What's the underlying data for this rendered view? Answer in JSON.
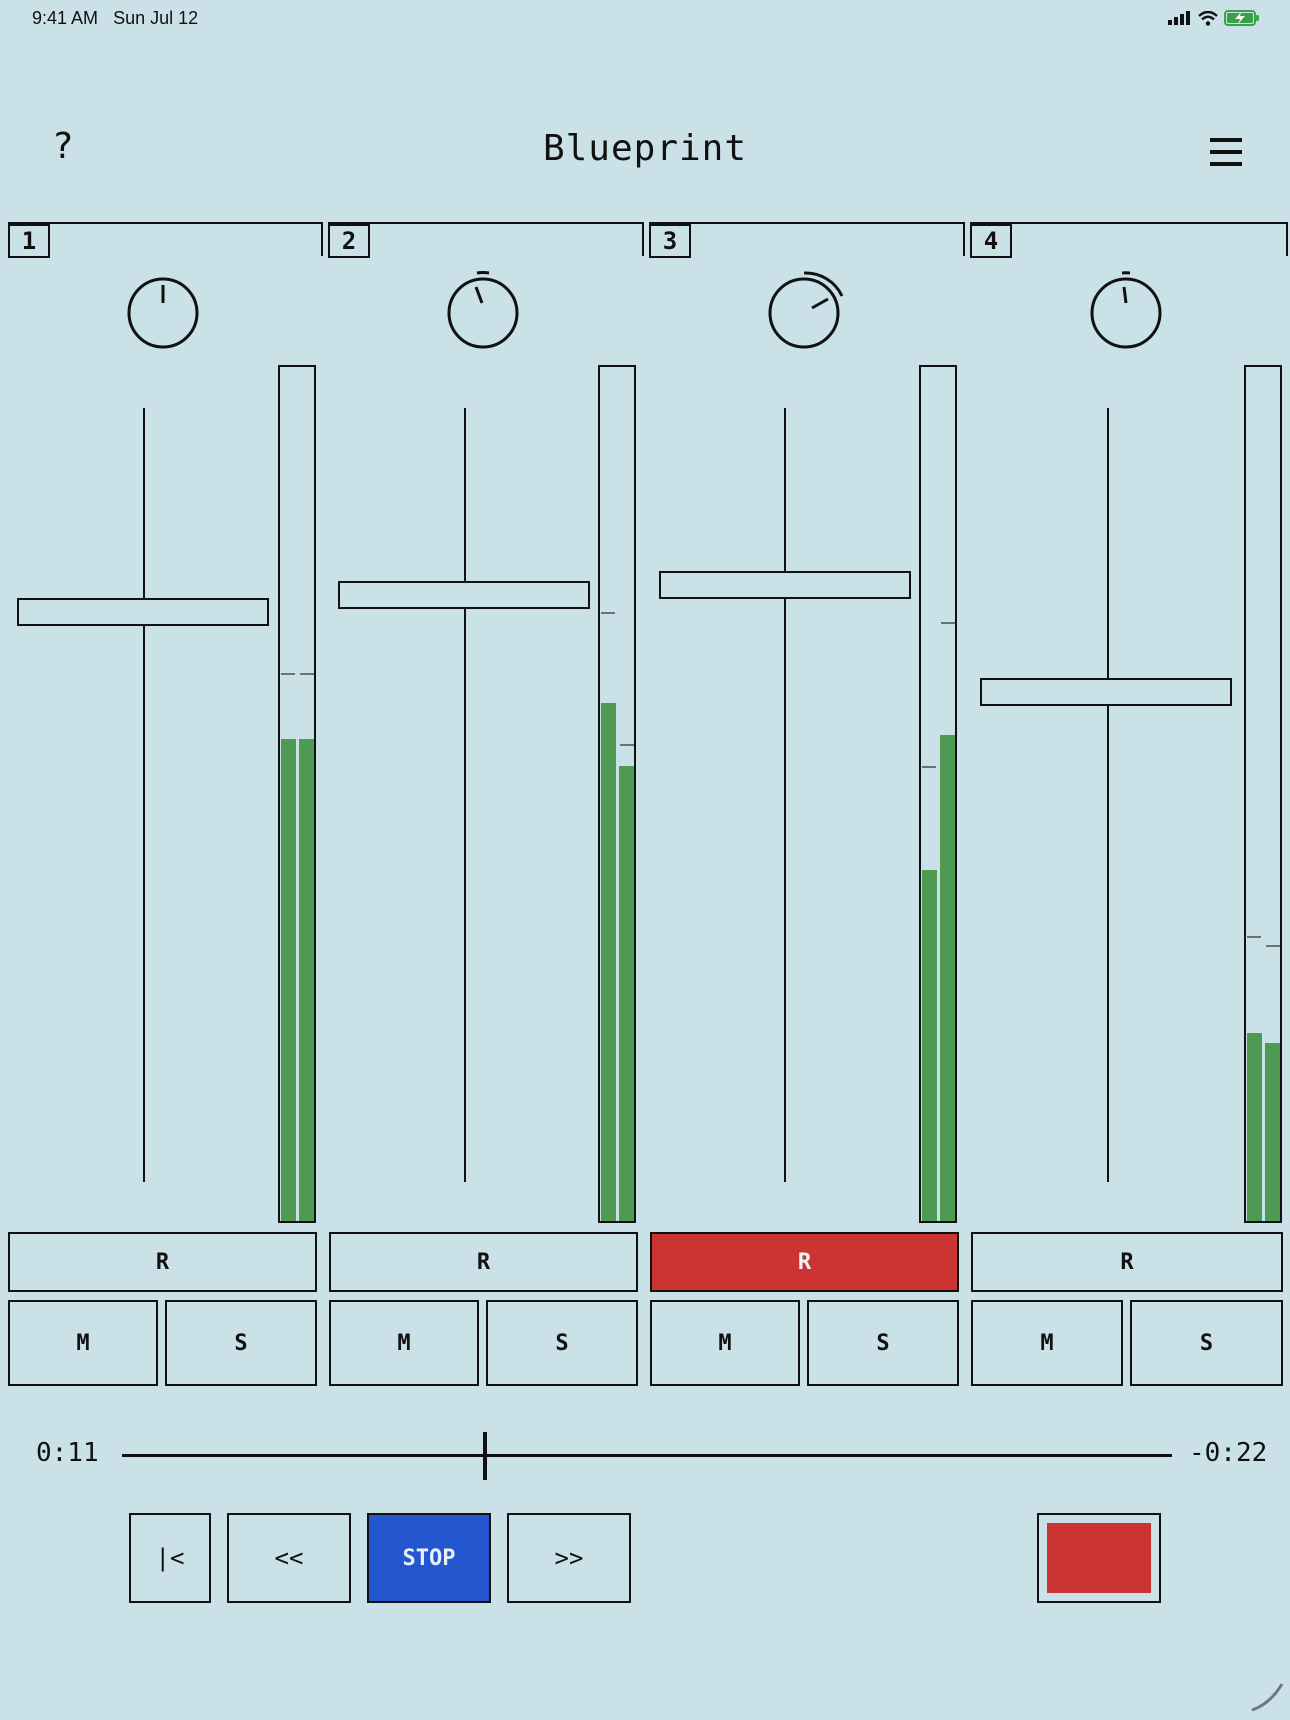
{
  "status_bar": {
    "time": "9:41 AM",
    "date": "Sun Jul 12"
  },
  "header": {
    "help_label": "?",
    "title": "Blueprint"
  },
  "colors": {
    "background": "#cae1e8",
    "meter_green": "#4e9a52",
    "record_red": "#cc3333",
    "stop_blue": "#2456cf"
  },
  "channels": [
    {
      "number": "1",
      "record_label": "R",
      "mute_label": "M",
      "solo_label": "S",
      "record_armed": false
    },
    {
      "number": "2",
      "record_label": "R",
      "mute_label": "M",
      "solo_label": "S",
      "record_armed": false
    },
    {
      "number": "3",
      "record_label": "R",
      "mute_label": "M",
      "solo_label": "S",
      "record_armed": true
    },
    {
      "number": "4",
      "record_label": "R",
      "mute_label": "M",
      "solo_label": "S",
      "record_armed": false
    }
  ],
  "transport": {
    "elapsed": "0:11",
    "remaining": "-0:22",
    "to_start_label": "|<",
    "rewind_label": "<<",
    "stop_label": "STOP",
    "forward_label": ">>"
  }
}
